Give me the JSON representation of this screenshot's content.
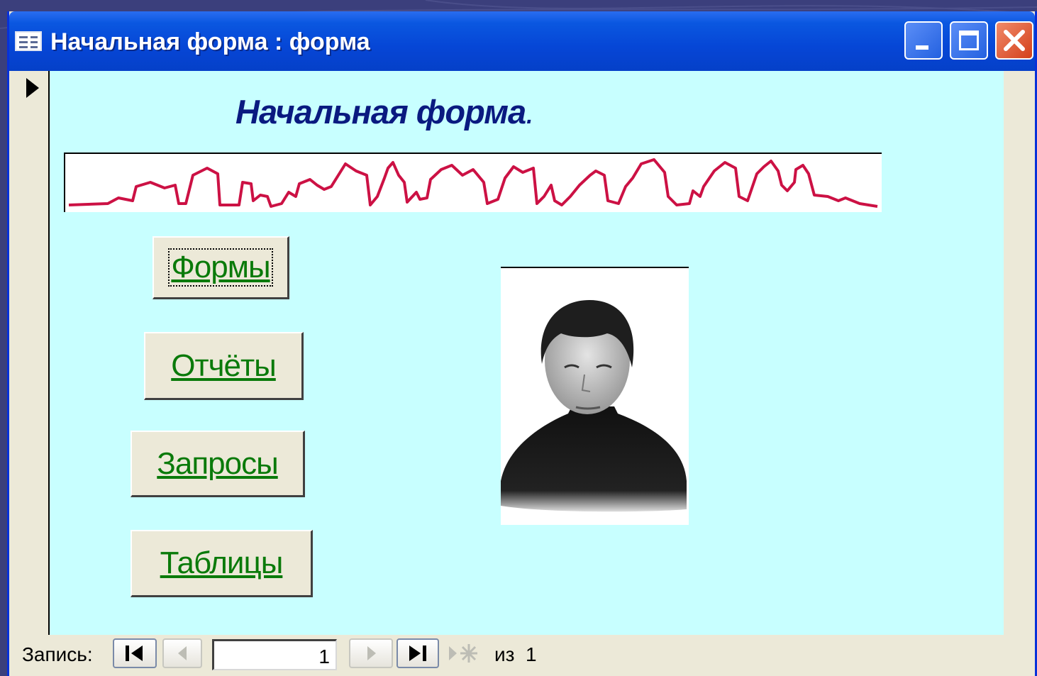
{
  "window": {
    "title": "Начальная форма : форма",
    "controls": [
      "minimize-icon",
      "maximize-icon",
      "close-icon"
    ]
  },
  "form": {
    "heading": "Начальная форма",
    "heading_dot": ".",
    "background_color": "#c8ffff",
    "heading_color": "#0a1a80",
    "link_color": "#0a7a0a",
    "banner_color": "#cc1144",
    "buttons": {
      "forms": "Формы",
      "reports": "Отчёты",
      "queries": "Запросы",
      "tables": "Таблицы"
    }
  },
  "navigation": {
    "label": "Запись:",
    "current_record": "1",
    "of_label": "из",
    "total_records": "1",
    "icons": [
      "first-record-icon",
      "prev-record-icon",
      "next-record-icon",
      "last-record-icon",
      "new-record-icon"
    ]
  }
}
